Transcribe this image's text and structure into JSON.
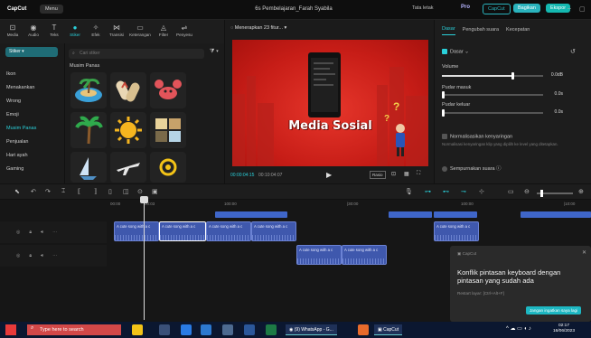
{
  "titlebar": {
    "logo": "CapCut",
    "menu": "Menu",
    "doc_title": "6s Pembelajaran_Farah Syabila",
    "layout_label": "Tata letak",
    "pro": "Pro",
    "btn_outline": "CapCut",
    "btn_share": "Bagikan",
    "btn_export": "Ekspor"
  },
  "toolbar": {
    "items": [
      {
        "label": "Media",
        "icon": "media-icon"
      },
      {
        "label": "Audio",
        "icon": "audio-icon"
      },
      {
        "label": "Teks",
        "icon": "text-icon"
      },
      {
        "label": "Stiker",
        "icon": "sticker-icon"
      },
      {
        "label": "Efek",
        "icon": "effects-icon"
      },
      {
        "label": "Transisi",
        "icon": "transition-icon"
      },
      {
        "label": "Keterangan",
        "icon": "captions-icon"
      },
      {
        "label": "Filter",
        "icon": "filter-icon"
      },
      {
        "label": "Penyesu",
        "icon": "adjust-icon"
      }
    ],
    "active_index": 3
  },
  "sidebar": {
    "dropdown": "Stiker",
    "items": [
      "Ikon",
      "Menakankan",
      "Wrong",
      "Emoji",
      "Musim Panas",
      "Penjualan",
      "Hari ayah",
      "Gaming"
    ],
    "active_index": 4
  },
  "panel": {
    "search_placeholder": "Cari stiker",
    "section": "Musim Panas"
  },
  "player": {
    "header": "Menerapkan 23 fitur...",
    "video_title": "Media Sosial",
    "time_current": "00:00:04:15",
    "time_total": "00:10:04:07",
    "ratio": "Rasio"
  },
  "inspector": {
    "tabs": [
      "Dasar",
      "Pengubah suara",
      "Kecepatan"
    ],
    "active_tab": 0,
    "section": "Dasar",
    "volume_label": "Volume",
    "volume_value": "0.0dB",
    "fade_in_label": "Pudar masuk",
    "fade_in_value": "0.0s",
    "fade_out_label": "Pudar keluar",
    "fade_out_value": "0.0s",
    "normalize_label": "Normalisasikan kenyaringan",
    "normalize_desc": "Normalisasi kenyaringan klip yang dipilih ke level yang ditetapkan.",
    "enhance_label": "Sempurnakan suara",
    "volume_level": 0.7
  },
  "timeline": {
    "ruler": [
      "00:00",
      "00:03",
      "100:00",
      "|30:00",
      "100:00",
      "|10:00"
    ],
    "clip_label": "A cute song with a c",
    "row1_clips": 6,
    "row2_clips": 2
  },
  "toast": {
    "source": "CapCut",
    "message": "Konflik pintasan keyboard dengan pintasan yang sudah ada",
    "hint": "Restart layar: [Ctrl+Alt+F]",
    "button": "Jangan ingatkan saya lagi"
  },
  "taskbar": {
    "search": "Type here to search",
    "whatsapp": "(9) WhatsApp - G...",
    "capcut": "CapCut",
    "time": "02:17",
    "date": "16/06/2023"
  }
}
